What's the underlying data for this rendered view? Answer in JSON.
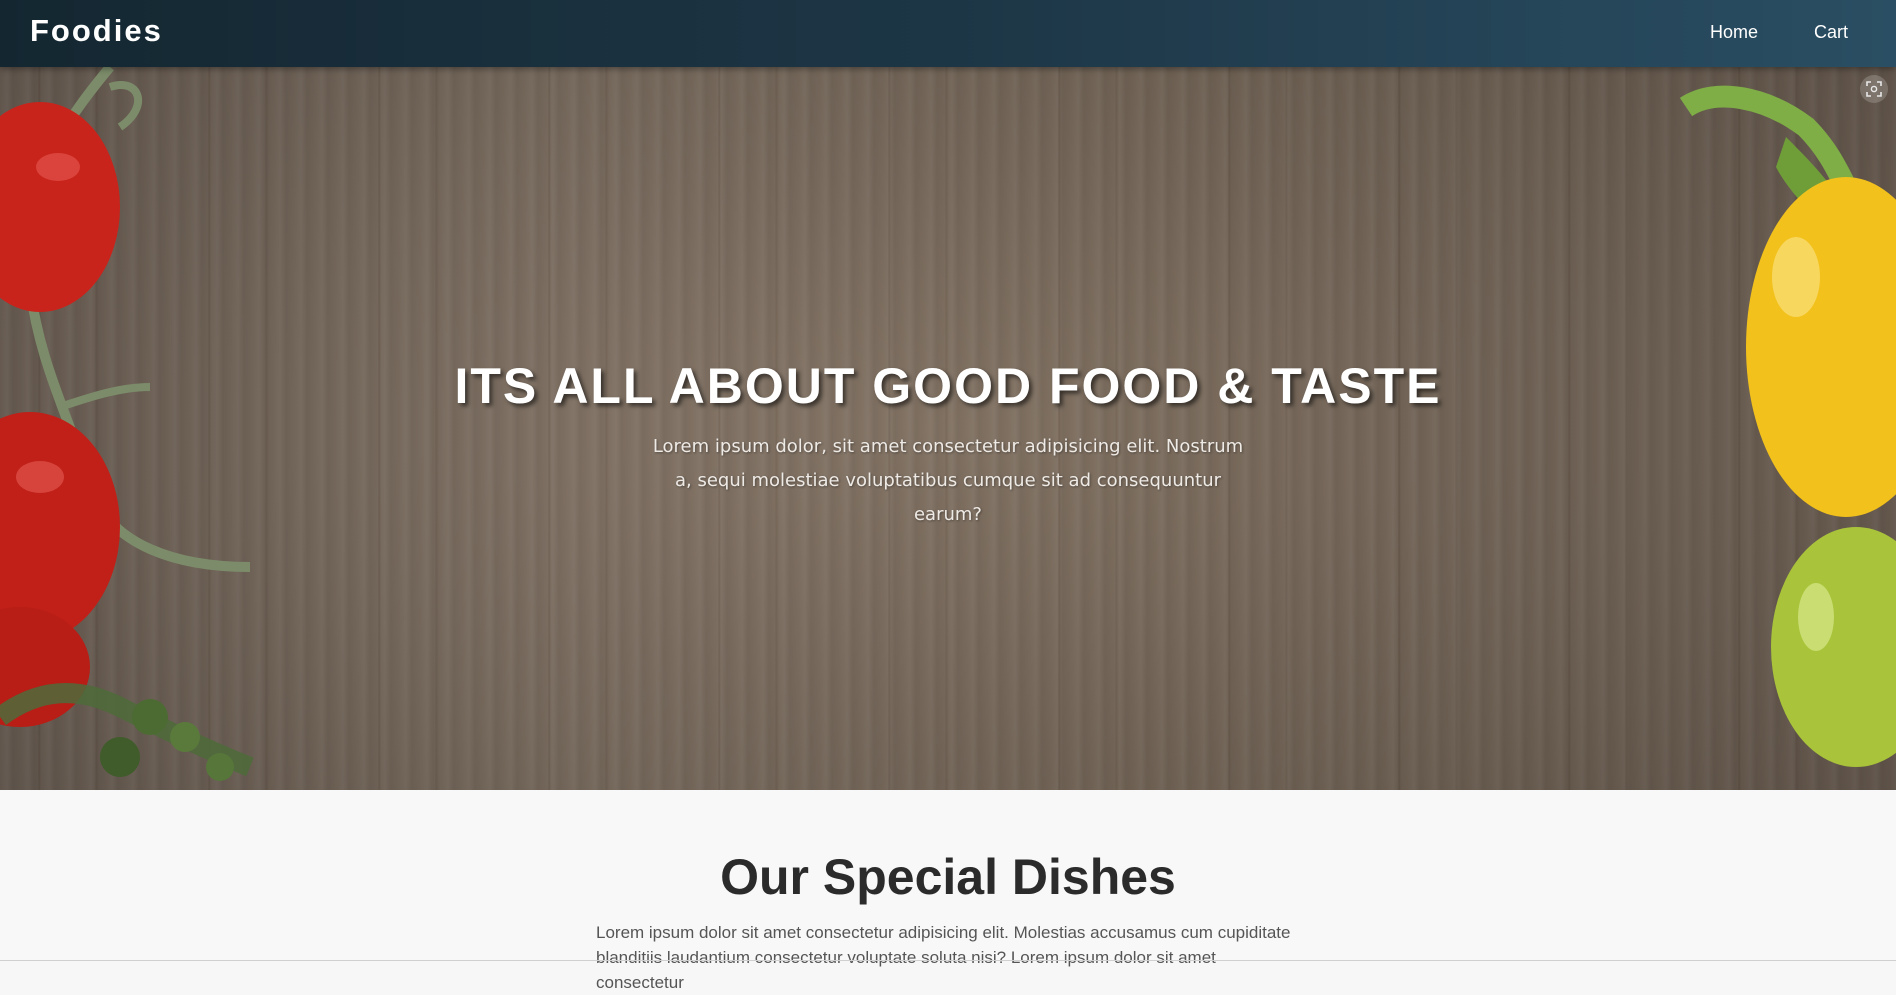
{
  "nav": {
    "brand": "Foodies",
    "links": [
      "Home",
      "Cart"
    ]
  },
  "hero": {
    "title": "ITS ALL ABOUT GOOD FOOD & TASTE",
    "text": "Lorem ipsum dolor, sit amet consectetur adipisicing elit. Nostrum a, sequi molestiae voluptatibus cumque sit ad consequuntur earum?"
  },
  "special": {
    "title": "Our Special Dishes",
    "text": "Lorem ipsum dolor sit amet consectetur adipisicing elit. Molestias accusamus cum cupiditate blanditiis laudantium consectetur voluptate soluta nisi? Lorem ipsum dolor sit amet consectetur"
  },
  "icons": {
    "screenshot": "screenshot-icon"
  }
}
